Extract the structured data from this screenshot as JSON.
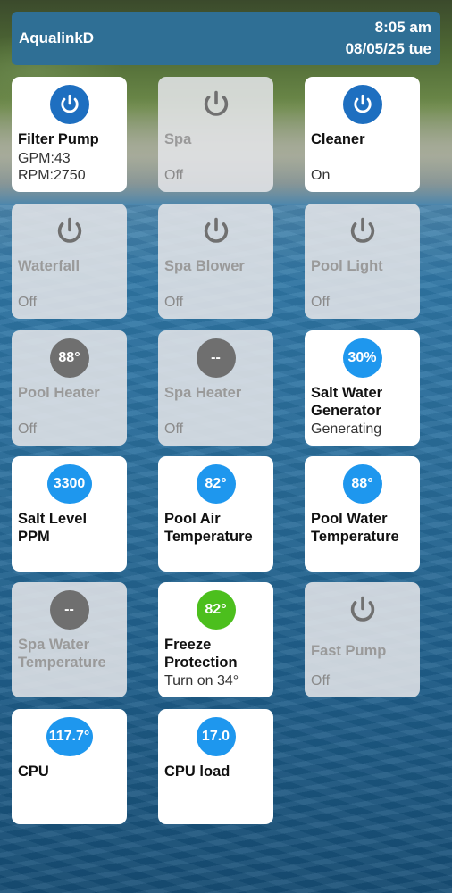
{
  "header": {
    "title": "AqualinkD",
    "time": "8:05 am",
    "date": "08/05/25 tue"
  },
  "tiles": [
    {
      "label": "Filter Pump",
      "line1": "GPM:43",
      "line2": "RPM:2750",
      "icon": "power-icon",
      "state": "on"
    },
    {
      "label": "Spa",
      "status": "Off",
      "icon": "power-icon",
      "state": "off"
    },
    {
      "label": "Cleaner",
      "status": "On",
      "icon": "power-icon",
      "state": "on"
    },
    {
      "label": "Waterfall",
      "status": "Off",
      "icon": "power-icon",
      "state": "off"
    },
    {
      "label": "Spa Blower",
      "status": "Off",
      "icon": "power-icon",
      "state": "off"
    },
    {
      "label": "Pool Light",
      "status": "Off",
      "icon": "power-icon",
      "state": "off"
    },
    {
      "label": "Pool Heater",
      "status": "Off",
      "value": "88°",
      "state": "off"
    },
    {
      "label": "Spa Heater",
      "status": "Off",
      "value": "--",
      "state": "off"
    },
    {
      "label": "Salt Water Generator",
      "status": "Generating",
      "value": "30%",
      "state": "on"
    },
    {
      "label": "Salt Level PPM",
      "value": "3300",
      "state": "on"
    },
    {
      "label": "Pool Air Temperature",
      "value": "82°",
      "state": "on"
    },
    {
      "label": "Pool Water Temperature",
      "value": "88°",
      "state": "on"
    },
    {
      "label": "Spa Water Temperature",
      "value": "--",
      "state": "off"
    },
    {
      "label": "Freeze Protection",
      "status": "Turn on 34°",
      "value": "82°",
      "state": "on"
    },
    {
      "label": "Fast Pump",
      "status": "Off",
      "icon": "power-icon",
      "state": "off"
    },
    {
      "label": "CPU",
      "value": "117.7°",
      "state": "on"
    },
    {
      "label": "CPU load",
      "value": "17.0",
      "state": "on"
    }
  ],
  "colors": {
    "header_bg": "#2f6f95",
    "power_on": "#1e6fc0",
    "value_blue": "#1e97ee",
    "value_green": "#4cbf1d",
    "value_gray": "#6f6f6f"
  }
}
